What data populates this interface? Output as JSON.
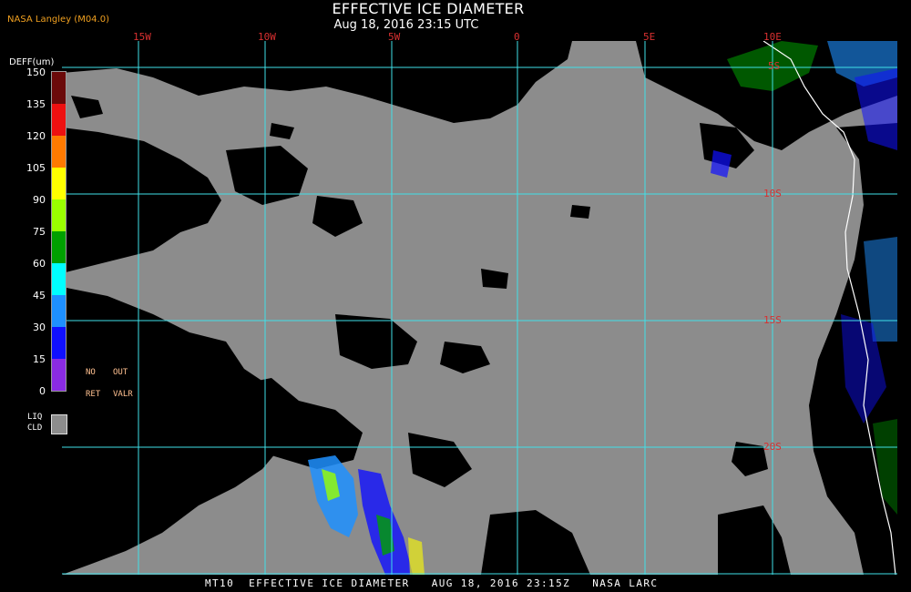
{
  "header": {
    "title": "EFFECTIVE ICE DIAMETER",
    "subtitle": "Aug 18, 2016 23:15 UTC",
    "producer": "NASA Langley (M04.0)"
  },
  "map": {
    "longitude_labels": [
      "15W",
      "10W",
      "5W",
      "0",
      "5E",
      "10E"
    ],
    "latitude_labels": [
      "5S",
      "10S",
      "15S",
      "20S"
    ],
    "colors": {
      "grid": "#40e0e8",
      "liquid_cloud": "#8c8c8c",
      "clear": "#000000",
      "coastline": "#ffffff",
      "label": "#d83030"
    }
  },
  "legend": {
    "unit_label": "DEFF(um)",
    "ticks": [
      "150",
      "135",
      "120",
      "105",
      "90",
      "75",
      "60",
      "45",
      "30",
      "15",
      "0"
    ],
    "segments": [
      "#6b0a0a",
      "#ee1010",
      "#ff7a00",
      "#ffff00",
      "#9aff00",
      "#00a000",
      "#00ffff",
      "#1e90ff",
      "#1010ff",
      "#8a2be2"
    ],
    "no_ret_line1": "NO",
    "no_ret_line2": "RET",
    "out_valr_line1": "OUT",
    "out_valr_line2": "VALR",
    "liq_line1": "LIQ",
    "liq_line2": "CLD"
  },
  "footer": {
    "text": "MT10  EFFECTIVE ICE DIAMETER   AUG 18, 2016 23:15Z   NASA LARC"
  }
}
